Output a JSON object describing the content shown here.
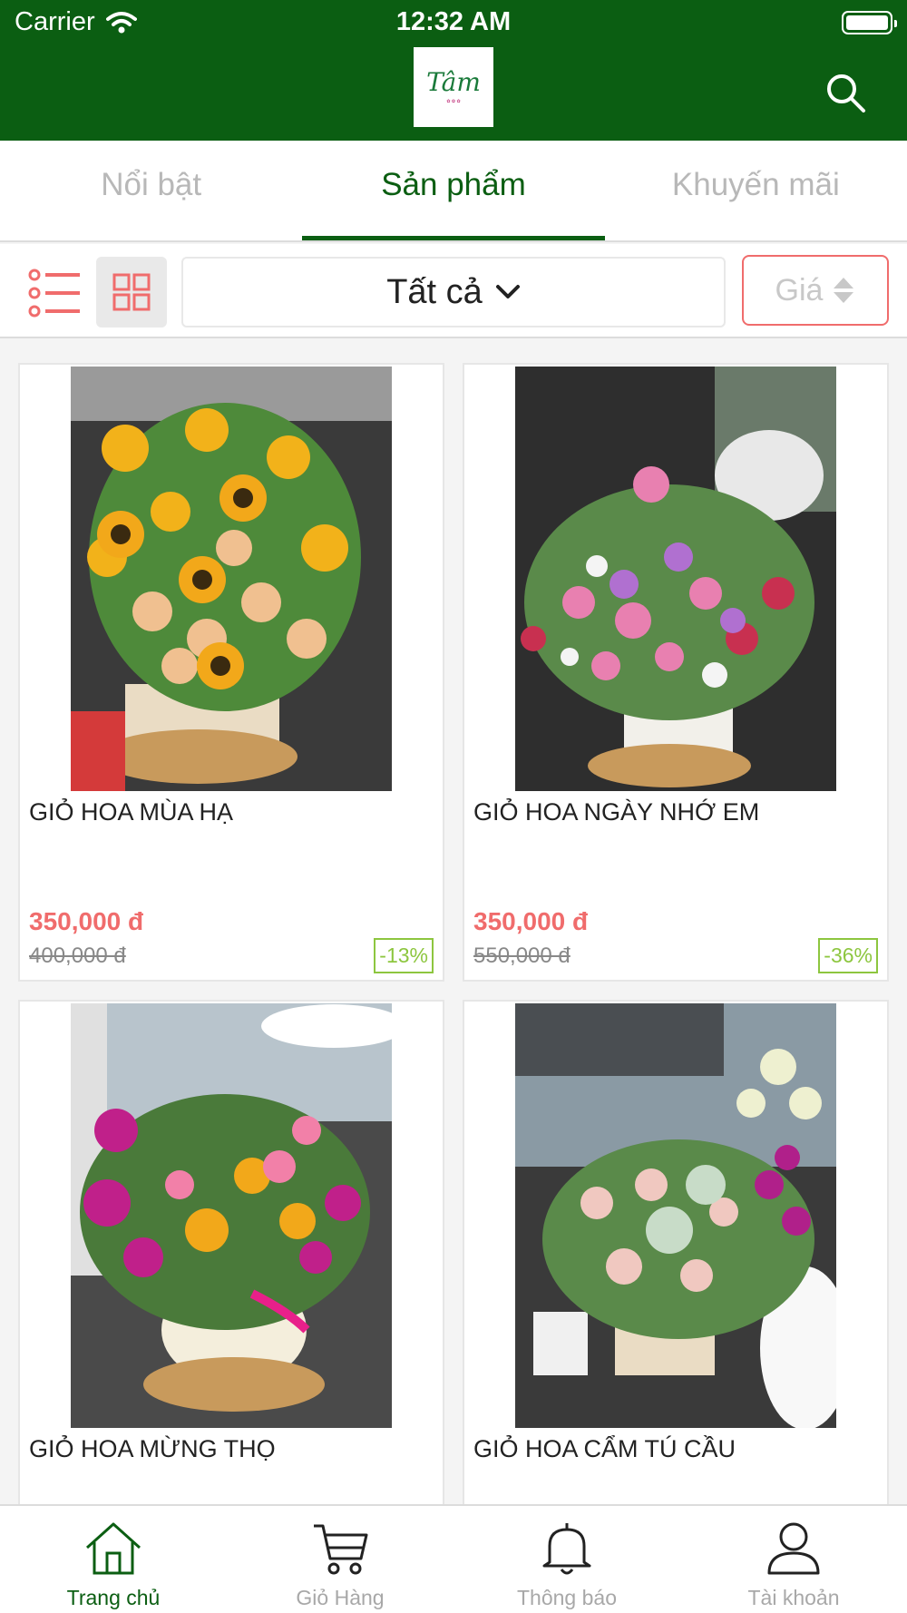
{
  "status": {
    "carrier": "Carrier",
    "time": "12:32 AM"
  },
  "header": {
    "logo_text": "Tâm",
    "search_icon": "search-icon"
  },
  "tabs": [
    {
      "label": "Nổi bật",
      "active": false
    },
    {
      "label": "Sản phẩm",
      "active": true
    },
    {
      "label": "Khuyến mãi",
      "active": false
    }
  ],
  "filters": {
    "category": "Tất cả",
    "sort_label": "Giá"
  },
  "products": [
    {
      "name": "GIỎ HOA MÙA HẠ",
      "price": "350,000 đ",
      "old_price": "400,000 đ",
      "discount": "-13%"
    },
    {
      "name": "GIỎ HOA NGÀY NHỚ EM",
      "price": "350,000 đ",
      "old_price": "550,000 đ",
      "discount": "-36%"
    },
    {
      "name": "GIỎ HOA MỪNG THỌ",
      "price": "",
      "old_price": "",
      "discount": ""
    },
    {
      "name": "GIỎ HOA CẨM TÚ CẦU",
      "price": "",
      "old_price": "",
      "discount": ""
    }
  ],
  "bottom_nav": [
    {
      "label": "Trang chủ",
      "icon": "home-icon",
      "active": true
    },
    {
      "label": "Giỏ Hàng",
      "icon": "cart-icon",
      "active": false
    },
    {
      "label": "Thông báo",
      "icon": "bell-icon",
      "active": false
    },
    {
      "label": "Tài khoản",
      "icon": "user-icon",
      "active": false
    }
  ],
  "colors": {
    "brand_green": "#0b5e12",
    "price_red": "#f06c6c",
    "discount_green": "#8dc63f"
  }
}
